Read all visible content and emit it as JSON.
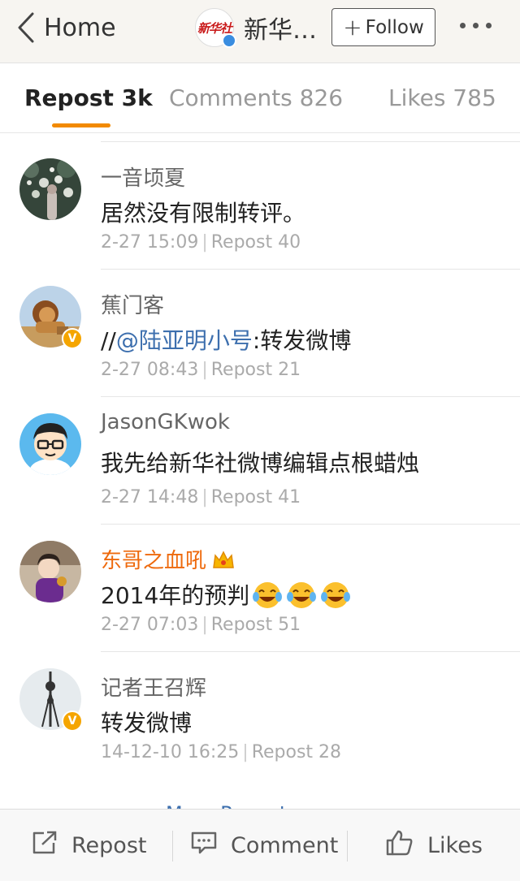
{
  "nav": {
    "back_label": "Home",
    "account_name": "新华…",
    "account_logo": "新华社",
    "follow_label": "Follow"
  },
  "tabs": [
    {
      "label": "Repost 3k"
    },
    {
      "label": "Comments 826"
    },
    {
      "label": "Likes 785"
    }
  ],
  "reposts": [
    {
      "user": "一音顷夏",
      "text": "居然没有限制转评。",
      "time": "2-27 15:09",
      "repost": "Repost 40",
      "verified": false
    },
    {
      "user": "蕉门客",
      "text_prefix": "//",
      "mention": "@陆亚明小号",
      "text_suffix": ":转发微博",
      "time": "2-27 08:43",
      "repost": "Repost 21",
      "verified": true
    },
    {
      "user": "JasonGKwok",
      "text": "我先给新华社微博编辑点根蜡烛",
      "time": "2-27 14:48",
      "repost": "Repost 41",
      "verified": false
    },
    {
      "user": "东哥之血吼",
      "text": "2014年的预判",
      "time": "2-27 07:03",
      "repost": "Repost 51",
      "verified": false,
      "vip": true
    },
    {
      "user": "记者王召辉",
      "text": "转发微博",
      "time": "14-12-10 16:25",
      "repost": "Repost 28",
      "verified": true
    }
  ],
  "more_link": "More Reposts",
  "bottom": {
    "repost_label": "Repost",
    "comment_label": "Comment",
    "likes_label": "Likes"
  },
  "colors": {
    "accent": "#f28a00",
    "link": "#3d6fae",
    "vip_name": "#ee6a0d",
    "verified_badge": "#f5a500"
  }
}
